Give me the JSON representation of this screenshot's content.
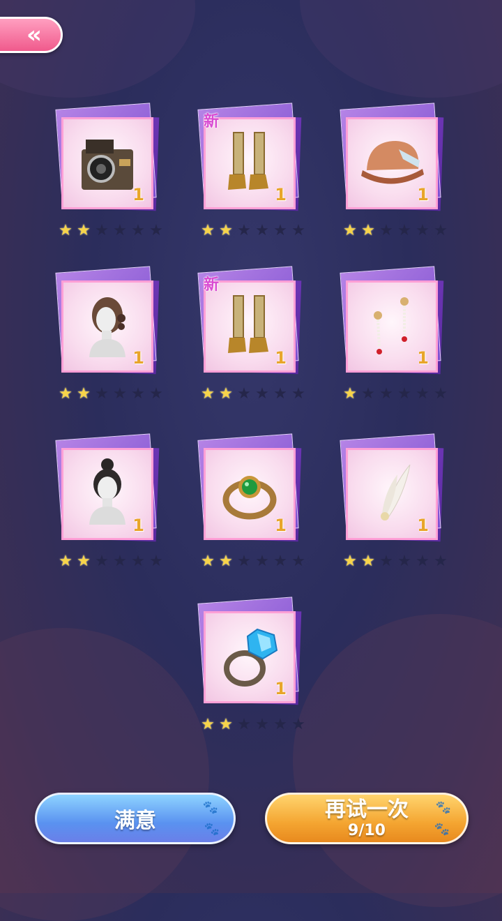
{
  "back_button": {
    "icon": "double-chevron-left-icon",
    "glyph": "«"
  },
  "items": [
    {
      "name": "vintage-camera",
      "count": "1",
      "new_label": "",
      "stars": 2,
      "max_stars": 6
    },
    {
      "name": "golden-boots",
      "count": "1",
      "new_label": "新",
      "stars": 2,
      "max_stars": 6
    },
    {
      "name": "cloche-hat",
      "count": "1",
      "new_label": "",
      "stars": 2,
      "max_stars": 6
    },
    {
      "name": "curly-updo-hair",
      "count": "1",
      "new_label": "",
      "stars": 2,
      "max_stars": 6
    },
    {
      "name": "golden-boots",
      "count": "1",
      "new_label": "新",
      "stars": 2,
      "max_stars": 6
    },
    {
      "name": "pearl-earrings",
      "count": "1",
      "new_label": "",
      "stars": 1,
      "max_stars": 6
    },
    {
      "name": "bun-hair",
      "count": "1",
      "new_label": "",
      "stars": 2,
      "max_stars": 6
    },
    {
      "name": "emerald-ring",
      "count": "1",
      "new_label": "",
      "stars": 2,
      "max_stars": 6
    },
    {
      "name": "feather-hairpin",
      "count": "1",
      "new_label": "",
      "stars": 2,
      "max_stars": 6
    },
    {
      "name": "sapphire-ring",
      "count": "1",
      "new_label": "",
      "stars": 2,
      "max_stars": 6
    }
  ],
  "buttons": {
    "satisfied_label": "满意",
    "retry_label": "再试一次",
    "retry_count": "9/10"
  },
  "colors": {
    "star_on": "#f7d44a",
    "card_border": "#ff9fd6",
    "count_text": "#e8a52a",
    "new_text": "#d94bd2"
  }
}
